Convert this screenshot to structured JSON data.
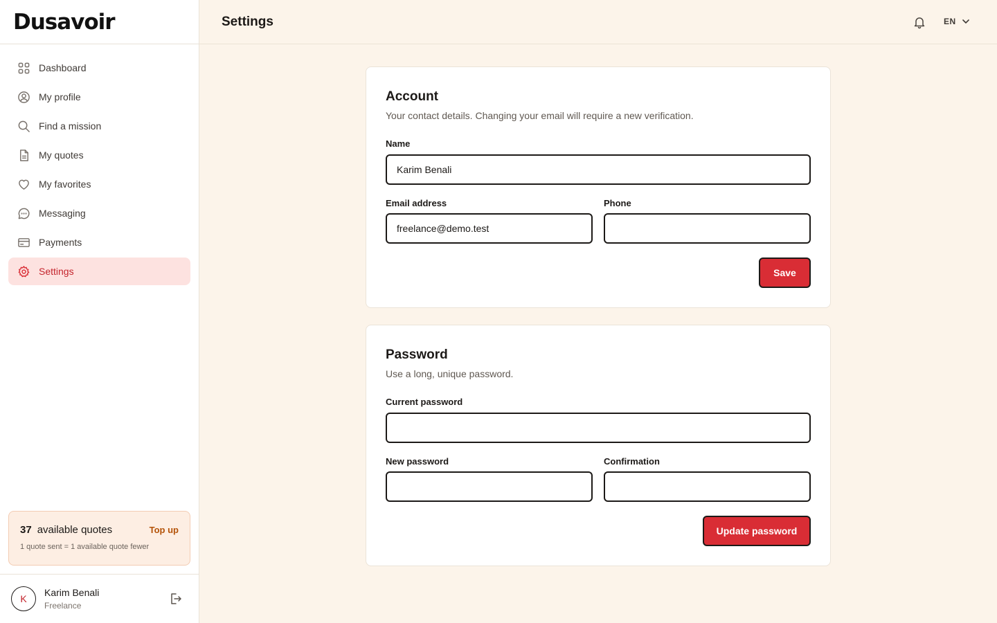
{
  "brand": {
    "name": "Dusavoir"
  },
  "sidebar": {
    "items": [
      {
        "label": "Dashboard",
        "icon": "grid-icon"
      },
      {
        "label": "My profile",
        "icon": "user-circle-icon"
      },
      {
        "label": "Find a mission",
        "icon": "search-icon"
      },
      {
        "label": "My quotes",
        "icon": "document-icon"
      },
      {
        "label": "My favorites",
        "icon": "heart-icon"
      },
      {
        "label": "Messaging",
        "icon": "chat-icon"
      },
      {
        "label": "Payments",
        "icon": "credit-card-icon"
      },
      {
        "label": "Settings",
        "icon": "gear-icon",
        "active": true
      }
    ],
    "quota": {
      "count": "37",
      "label": "available quotes",
      "topup_label": "Top up",
      "note": "1 quote sent = 1 available quote fewer"
    },
    "user": {
      "initial": "K",
      "name": "Karim Benali",
      "role": "Freelance"
    }
  },
  "header": {
    "title": "Settings",
    "language": "EN"
  },
  "account": {
    "title": "Account",
    "description": "Your contact details. Changing your email will require a new verification.",
    "name_label": "Name",
    "name_value": "Karim Benali",
    "email_label": "Email address",
    "email_value": "freelance@demo.test",
    "phone_label": "Phone",
    "phone_value": "",
    "save_label": "Save"
  },
  "password": {
    "title": "Password",
    "description": "Use a long, unique password.",
    "current_label": "Current password",
    "new_label": "New password",
    "confirm_label": "Confirmation",
    "update_label": "Update password"
  },
  "colors": {
    "accent": "#d92d35",
    "active_bg": "#fde2e0",
    "page_bg": "#fcf4ea",
    "quota_bg": "#fdeee3",
    "topup": "#b45309"
  }
}
